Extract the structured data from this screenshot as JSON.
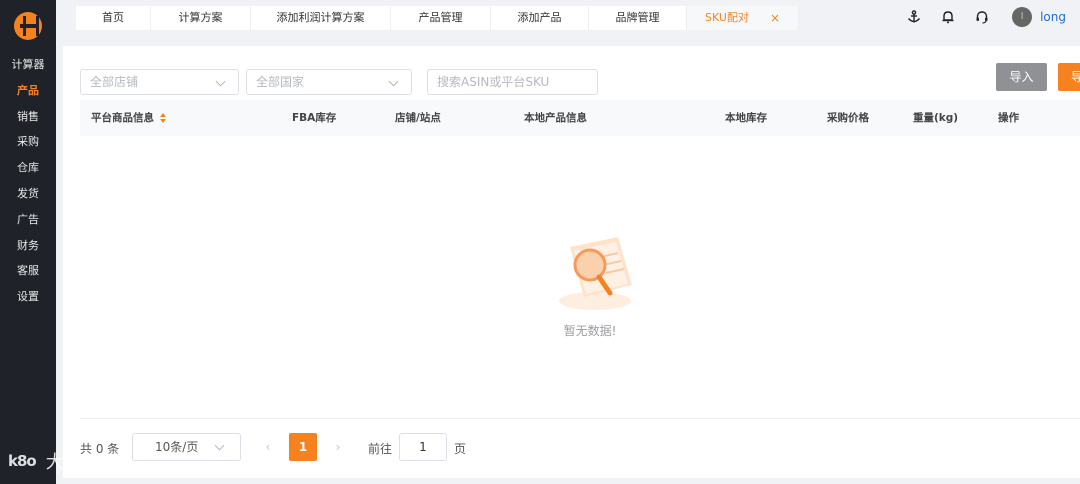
{
  "sidebar": {
    "items": [
      {
        "label": "计算器"
      },
      {
        "label": "产品"
      },
      {
        "label": "销售"
      },
      {
        "label": "采购"
      },
      {
        "label": "仓库"
      },
      {
        "label": "发货"
      },
      {
        "label": "广告"
      },
      {
        "label": "财务"
      },
      {
        "label": "客服"
      },
      {
        "label": "设置"
      }
    ]
  },
  "tabs": [
    {
      "label": "首页"
    },
    {
      "label": "计算方案"
    },
    {
      "label": "添加利润计算方案"
    },
    {
      "label": "产品管理"
    },
    {
      "label": "添加产品"
    },
    {
      "label": "品牌管理"
    },
    {
      "label": "SKU配对",
      "close": "×"
    }
  ],
  "header": {
    "username": "long",
    "avatar_initial": "l"
  },
  "filters": {
    "store_placeholder": "全部店铺",
    "country_placeholder": "全部国家",
    "search_placeholder": "搜索ASIN或平台SKU"
  },
  "actions": {
    "import_label": "导入",
    "export_label": "导"
  },
  "table": {
    "columns": [
      "平台商品信息",
      "FBA库存",
      "店铺/站点",
      "本地产品信息",
      "本地库存",
      "采购价格",
      "重量(kg)",
      "操作"
    ],
    "rows": []
  },
  "empty": {
    "text": "暂无数据!"
  },
  "pagination": {
    "total_text": "共 0 条",
    "page_size": "10条/页",
    "prev": "‹",
    "current_page": "1",
    "next": "›",
    "goto_label": "前往",
    "goto_value": "1",
    "page_suffix": "页"
  },
  "watermark": {
    "logo": "k8o",
    "text": "大数跨境"
  },
  "colors": {
    "accent": "#f5821f",
    "sidebar_bg": "#1f2329",
    "link": "#1f6fd1",
    "import_button": "#8f9194"
  }
}
